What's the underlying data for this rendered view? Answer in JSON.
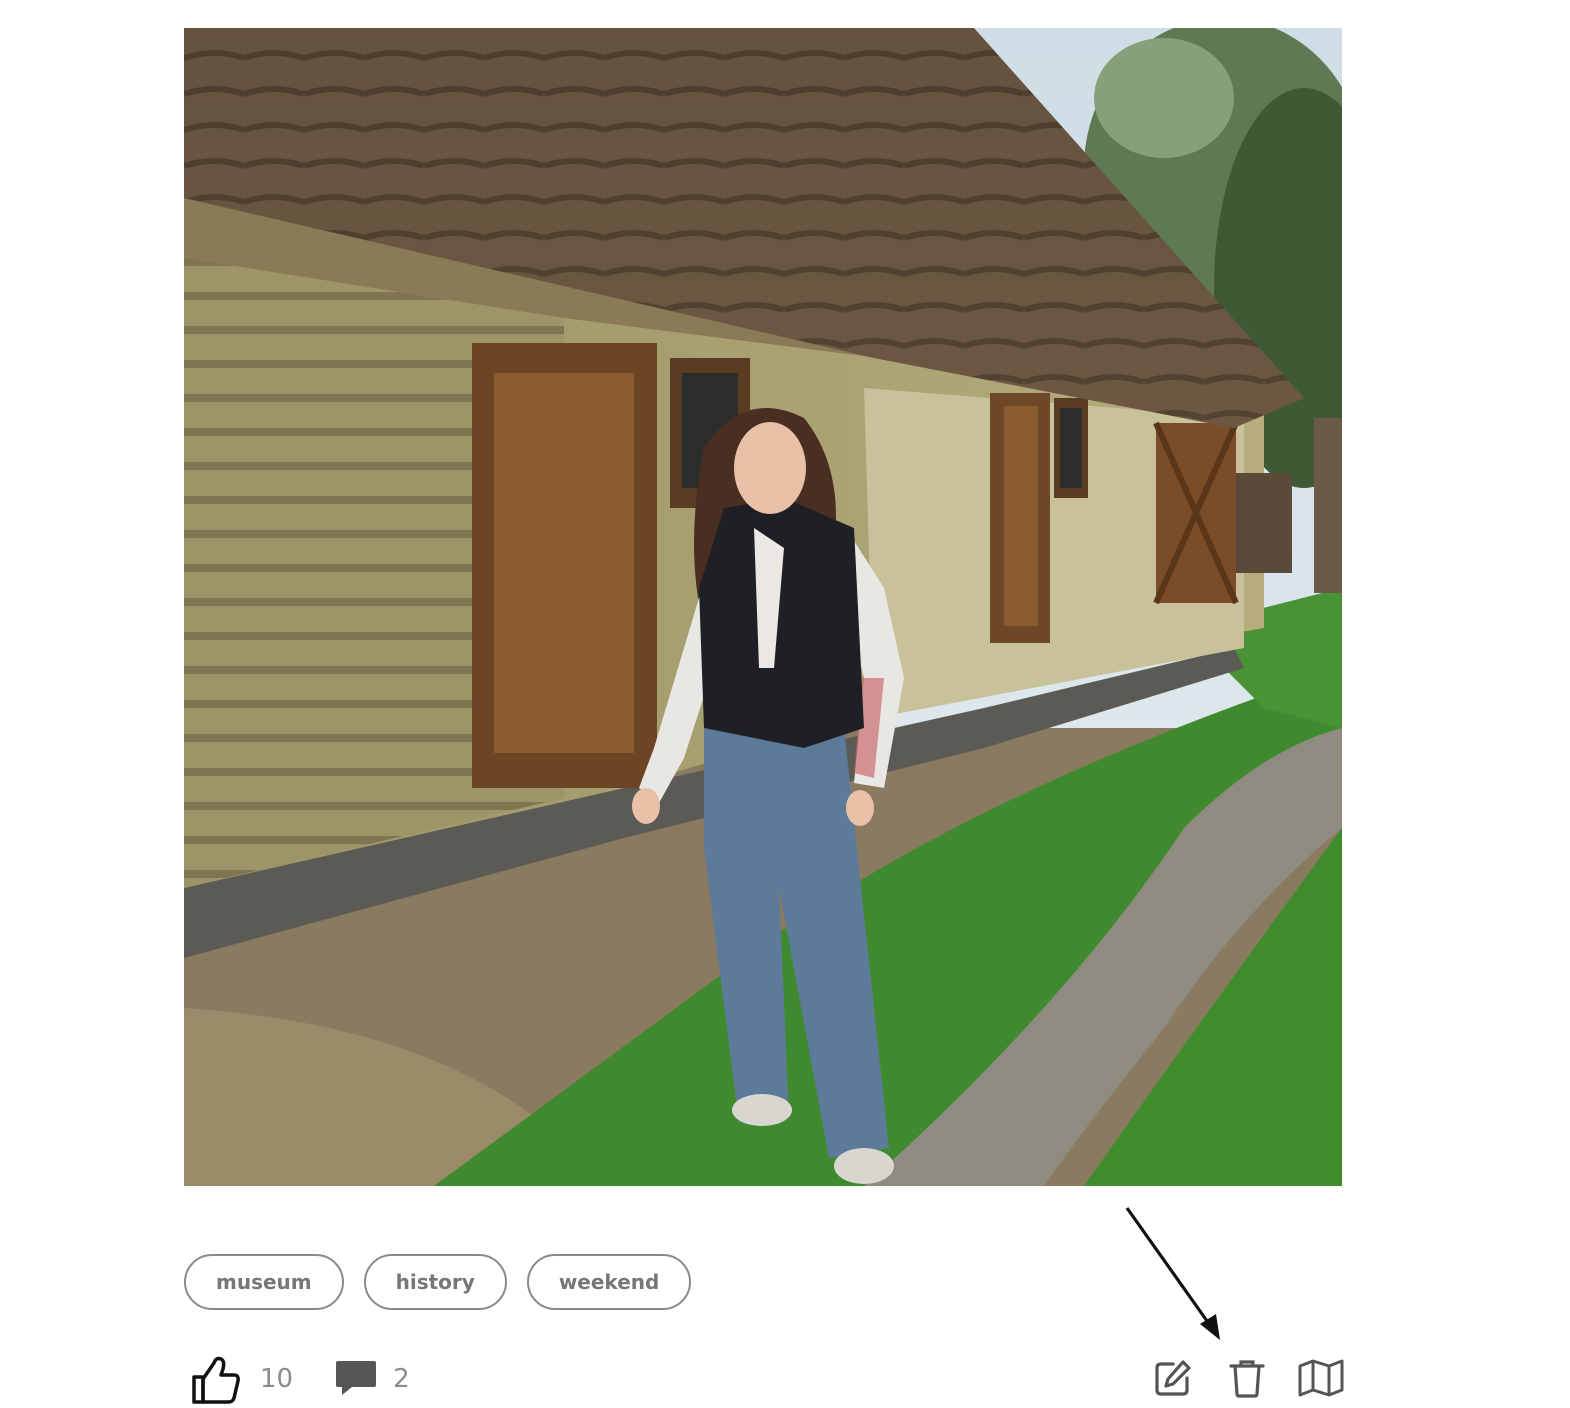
{
  "post": {
    "photo": {
      "icon": "photo-of-woman-at-thatched-wooden-house",
      "next_icon": "chevron-right-icon"
    },
    "tags": [
      "museum",
      "history",
      "weekend"
    ],
    "likes": {
      "icon": "thumbs-up-icon",
      "count": "10"
    },
    "comments": {
      "icon": "comment-icon",
      "count": "2"
    },
    "actions": [
      {
        "name": "edit",
        "icon": "edit-icon"
      },
      {
        "name": "delete",
        "icon": "trash-icon"
      },
      {
        "name": "map",
        "icon": "map-icon"
      }
    ]
  },
  "colors": {
    "accent": "#f2c518",
    "tag_border": "#8a8a8a",
    "text_muted": "#8c8c8c"
  }
}
